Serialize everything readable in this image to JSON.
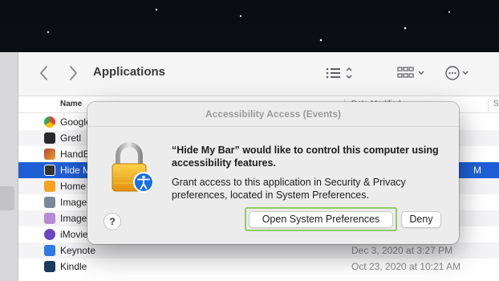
{
  "finder": {
    "window_title": "Applications",
    "columns": {
      "name": "Name",
      "date_modified": "Date Modified",
      "size": "S"
    },
    "rows": [
      {
        "name": "Google",
        "date": "",
        "icon": "chrome-icon",
        "color": "#e94335"
      },
      {
        "name": "Gretl",
        "date": "",
        "icon": "gretl-icon",
        "color": "#2a2a2a"
      },
      {
        "name": "HandB",
        "date": "",
        "icon": "handbrake-icon",
        "color": "#b5452a"
      },
      {
        "name": "Hide M",
        "date": "M",
        "icon": "hide-my-bar-icon",
        "color": "#333333",
        "selected": true
      },
      {
        "name": "Home",
        "date": "",
        "icon": "home-icon",
        "color": "#f4a21f"
      },
      {
        "name": "Image",
        "date": "",
        "icon": "image-capture-icon",
        "color": "#7a8899"
      },
      {
        "name": "Image",
        "date": "",
        "icon": "image-app-icon",
        "color": "#b58bd6"
      },
      {
        "name": "iMovie",
        "date": "",
        "icon": "imovie-icon",
        "color": "#6b46c1"
      },
      {
        "name": "Keynote",
        "date": "Dec 3, 2020 at 3:27 PM",
        "icon": "keynote-icon",
        "color": "#2e7be3"
      },
      {
        "name": "Kindle",
        "date": "Oct 23, 2020 at 10:21 AM",
        "icon": "kindle-icon",
        "color": "#1b3b5e"
      }
    ]
  },
  "dialog": {
    "title": "Accessibility Access (Events)",
    "heading": "“Hide My Bar” would like to control this computer using accessibility features.",
    "body": "Grant access to this application in Security & Privacy preferences, located in System Preferences.",
    "help_label": "?",
    "open_button_label": "Open System Preferences",
    "deny_button_label": "Deny"
  },
  "colors": {
    "selection": "#1f5fd6",
    "focus_ring": "#8fcb6a",
    "lock_gold": "#f0a81e",
    "accessibility_badge": "#1a6ee8"
  }
}
